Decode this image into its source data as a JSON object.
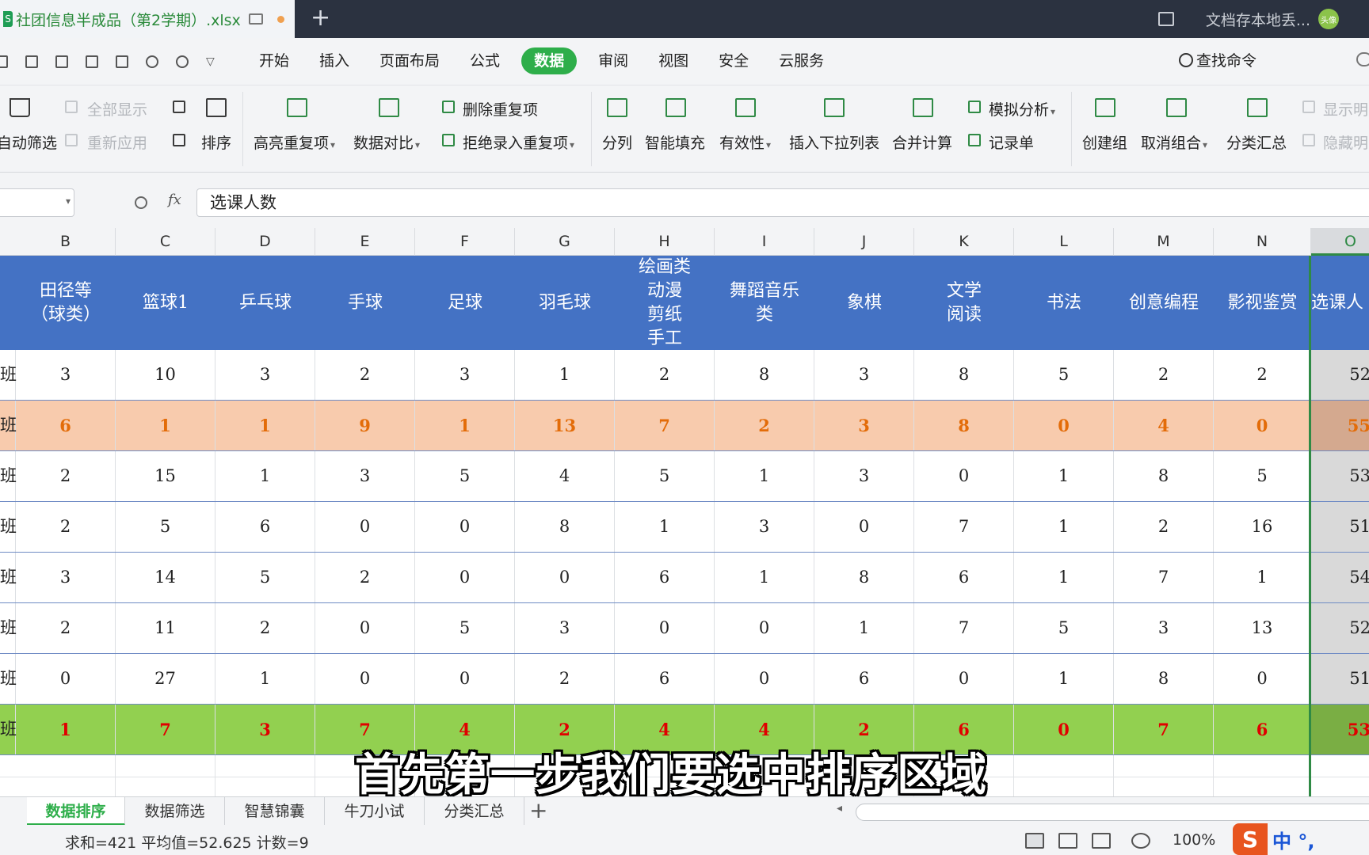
{
  "titlebar": {
    "file_name": "社团信息半成品（第2学期）.xlsx",
    "new_tab": "+",
    "cloud_status": "文档存本地丢...",
    "avatar_text": "头像"
  },
  "menu": {
    "items": [
      "开始",
      "插入",
      "页面布局",
      "公式",
      "数据",
      "审阅",
      "视图",
      "安全",
      "云服务"
    ],
    "active": "数据",
    "find": "查找命令"
  },
  "ribbon": {
    "auto_filter": "自动筛选",
    "show_all": "全部显示",
    "reapply": "重新应用",
    "sort": "排序",
    "highlight_dup": "高亮重复项",
    "data_compare": "数据对比",
    "remove_dup": "删除重复项",
    "reject_dup": "拒绝录入重复项",
    "split": "分列",
    "smart_fill": "智能填充",
    "validity": "有效性",
    "insert_dropdown": "插入下拉列表",
    "consolidate": "合并计算",
    "simulate": "模拟分析",
    "record_form": "记录单",
    "create_group": "创建组",
    "ungroup": "取消组合",
    "subtotal": "分类汇总",
    "show_detail": "显示明",
    "hide_detail": "隐藏明"
  },
  "formula_bar": {
    "fx": "fx",
    "content": "选课人数"
  },
  "columns": [
    "B",
    "C",
    "D",
    "E",
    "F",
    "G",
    "H",
    "I",
    "J",
    "K",
    "L",
    "M",
    "N",
    "O"
  ],
  "table": {
    "headers": [
      "田径等\n（球类）",
      "篮球1",
      "乒乓球",
      "手球",
      "足球",
      "羽毛球",
      "绘画类\n动漫\n剪纸\n手工",
      "舞蹈音乐\n类",
      "象棋",
      "文学\n阅读",
      "书法",
      "创意编程",
      "影视鉴赏",
      "选课人"
    ],
    "row_label": "班",
    "rows": [
      {
        "style": "normal",
        "values": [
          "3",
          "10",
          "3",
          "2",
          "3",
          "1",
          "2",
          "8",
          "3",
          "8",
          "5",
          "2",
          "2",
          "52"
        ]
      },
      {
        "style": "peach",
        "values": [
          "6",
          "1",
          "1",
          "9",
          "1",
          "13",
          "7",
          "2",
          "3",
          "8",
          "0",
          "4",
          "0",
          "55"
        ]
      },
      {
        "style": "normal",
        "values": [
          "2",
          "15",
          "1",
          "3",
          "5",
          "4",
          "5",
          "1",
          "3",
          "0",
          "1",
          "8",
          "5",
          "53"
        ]
      },
      {
        "style": "normal",
        "values": [
          "2",
          "5",
          "6",
          "0",
          "0",
          "8",
          "1",
          "3",
          "0",
          "7",
          "1",
          "2",
          "16",
          "51"
        ]
      },
      {
        "style": "normal",
        "values": [
          "3",
          "14",
          "5",
          "2",
          "0",
          "0",
          "6",
          "1",
          "8",
          "6",
          "1",
          "7",
          "1",
          "54"
        ]
      },
      {
        "style": "normal",
        "values": [
          "2",
          "11",
          "2",
          "0",
          "5",
          "3",
          "0",
          "0",
          "1",
          "7",
          "5",
          "3",
          "13",
          "52"
        ]
      },
      {
        "style": "normal",
        "values": [
          "0",
          "27",
          "1",
          "0",
          "0",
          "2",
          "6",
          "0",
          "6",
          "0",
          "1",
          "8",
          "0",
          "51"
        ]
      },
      {
        "style": "green",
        "values": [
          "1",
          "7",
          "3",
          "7",
          "4",
          "2",
          "4",
          "4",
          "2",
          "6",
          "0",
          "7",
          "6",
          "53"
        ]
      }
    ]
  },
  "subtitle": "首先第一步我们要选中排序区域",
  "sheets": {
    "tabs": [
      "数据排序",
      "数据筛选",
      "智慧锦囊",
      "牛刀小试",
      "分类汇总"
    ],
    "active": "数据排序",
    "add": "+"
  },
  "status": {
    "summary": "求和=421  平均值=52.625  计数=9",
    "zoom": "100%",
    "ime_logo": "S",
    "ime_text": "中 °,"
  },
  "colors": {
    "header_band": "#4472c4",
    "peach_row": "#f8cbad",
    "green_row": "#92d050",
    "accent": "#2eae4a"
  }
}
